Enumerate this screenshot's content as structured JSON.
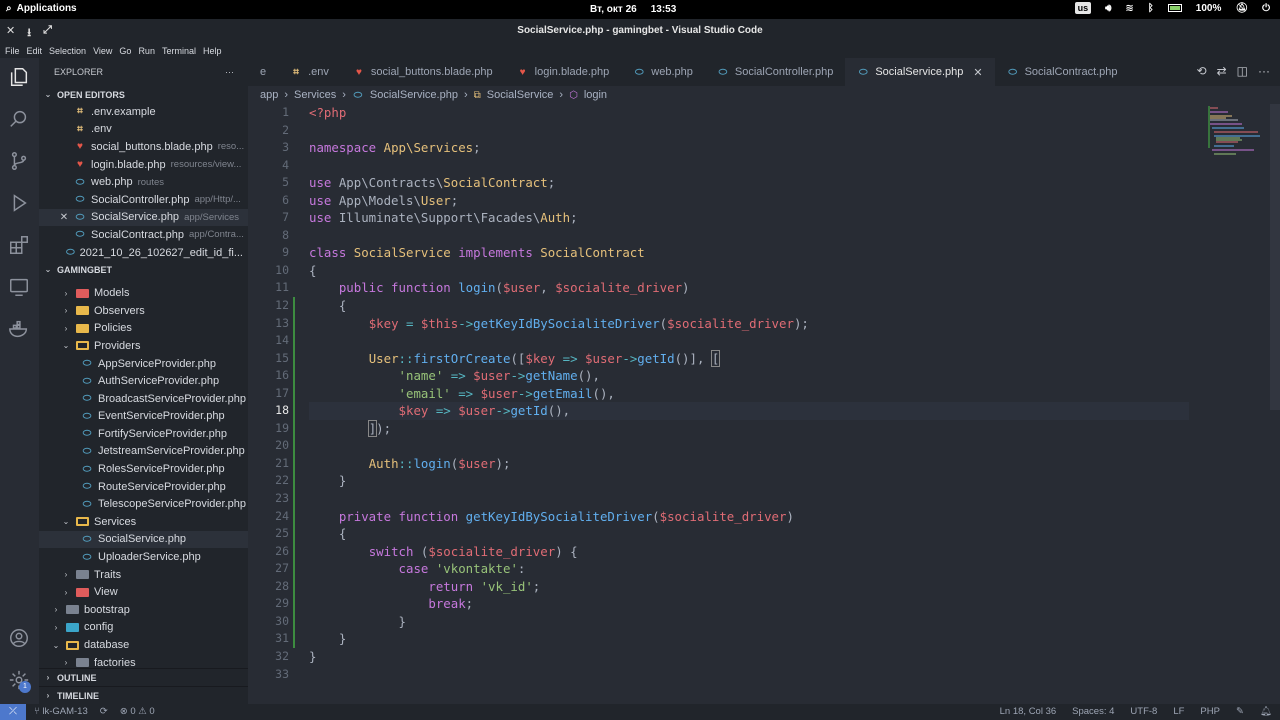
{
  "gnome": {
    "apps_label": "Applications",
    "date": "Вт, окт 26",
    "time": "13:53",
    "lang": "us",
    "battery": "100%"
  },
  "window": {
    "title": "SocialService.php - gamingbet - Visual Studio Code"
  },
  "menu": [
    "File",
    "Edit",
    "Selection",
    "View",
    "Go",
    "Run",
    "Terminal",
    "Help"
  ],
  "sidebar": {
    "title": "EXPLORER",
    "more": "···",
    "open_editors_label": "OPEN EDITORS",
    "open_editors": [
      {
        "icon": "env",
        "glyph": "⌗",
        "name": ".env.example",
        "desc": ""
      },
      {
        "icon": "env",
        "glyph": "⌗",
        "name": ".env",
        "desc": ""
      },
      {
        "icon": "blade",
        "glyph": "♥",
        "name": "social_buttons.blade.php",
        "desc": "reso..."
      },
      {
        "icon": "blade",
        "glyph": "♥",
        "name": "login.blade.php",
        "desc": "resources/view..."
      },
      {
        "icon": "php",
        "glyph": "⬭",
        "name": "web.php",
        "desc": "routes"
      },
      {
        "icon": "php",
        "glyph": "⬭",
        "name": "SocialController.php",
        "desc": "app/Http/..."
      },
      {
        "icon": "php",
        "glyph": "⬭",
        "name": "SocialService.php",
        "desc": "app/Services"
      },
      {
        "icon": "php",
        "glyph": "⬭",
        "name": "SocialContract.php",
        "desc": "app/Contra..."
      },
      {
        "icon": "php",
        "glyph": "⬭",
        "name": "2021_10_26_102627_edit_id_fi...",
        "desc": ""
      }
    ],
    "project_label": "GAMINGBET",
    "tree": [
      {
        "indent": 1,
        "type": "folder",
        "color": "r",
        "name": "Models",
        "chev": "›"
      },
      {
        "indent": 1,
        "type": "folder",
        "color": "y",
        "name": "Observers",
        "chev": "›"
      },
      {
        "indent": 1,
        "type": "folder",
        "color": "y",
        "name": "Policies",
        "chev": "›"
      },
      {
        "indent": 1,
        "type": "folder-open",
        "color": "y",
        "name": "Providers",
        "chev": "⌄"
      },
      {
        "indent": 2,
        "type": "file",
        "name": "AppServiceProvider.php"
      },
      {
        "indent": 2,
        "type": "file",
        "name": "AuthServiceProvider.php"
      },
      {
        "indent": 2,
        "type": "file",
        "name": "BroadcastServiceProvider.php"
      },
      {
        "indent": 2,
        "type": "file",
        "name": "EventServiceProvider.php"
      },
      {
        "indent": 2,
        "type": "file",
        "name": "FortifyServiceProvider.php"
      },
      {
        "indent": 2,
        "type": "file",
        "name": "JetstreamServiceProvider.php"
      },
      {
        "indent": 2,
        "type": "file",
        "name": "RolesServiceProvider.php"
      },
      {
        "indent": 2,
        "type": "file",
        "name": "RouteServiceProvider.php"
      },
      {
        "indent": 2,
        "type": "file",
        "name": "TelescopeServiceProvider.php"
      },
      {
        "indent": 1,
        "type": "folder-open",
        "color": "y",
        "name": "Services",
        "chev": "⌄"
      },
      {
        "indent": 2,
        "type": "file",
        "name": "SocialService.php",
        "selected": true
      },
      {
        "indent": 2,
        "type": "file",
        "name": "UploaderService.php"
      },
      {
        "indent": 1,
        "type": "folder",
        "color": "g",
        "name": "Traits",
        "chev": "›"
      },
      {
        "indent": 1,
        "type": "folder",
        "color": "r",
        "name": "View",
        "chev": "›"
      },
      {
        "indent": 0,
        "type": "folder",
        "color": "g",
        "name": "bootstrap",
        "chev": "›"
      },
      {
        "indent": 0,
        "type": "folder",
        "color": "b",
        "name": "config",
        "chev": "›"
      },
      {
        "indent": 0,
        "type": "folder-open",
        "color": "g",
        "name": "database",
        "chev": "⌄"
      },
      {
        "indent": 1,
        "type": "folder",
        "color": "g",
        "name": "factories",
        "chev": "›"
      }
    ],
    "outline_label": "OUTLINE",
    "timeline_label": "TIMELINE"
  },
  "tabs": [
    {
      "icon": "none",
      "glyph": "",
      "label": "e"
    },
    {
      "icon": "env",
      "glyph": "⌗",
      "label": ".env"
    },
    {
      "icon": "blade",
      "glyph": "♥",
      "label": "social_buttons.blade.php"
    },
    {
      "icon": "blade",
      "glyph": "♥",
      "label": "login.blade.php"
    },
    {
      "icon": "php",
      "glyph": "⬭",
      "label": "web.php"
    },
    {
      "icon": "php",
      "glyph": "⬭",
      "label": "SocialController.php"
    },
    {
      "icon": "php",
      "glyph": "⬭",
      "label": "SocialService.php",
      "active": true
    },
    {
      "icon": "php",
      "glyph": "⬭",
      "label": "SocialContract.php"
    }
  ],
  "breadcrumbs": {
    "p1": "app",
    "p2": "Services",
    "p3": "SocialService.php",
    "p4": "SocialService",
    "p5": "login",
    "sep": "›"
  },
  "editor": {
    "current_line": 18,
    "code_lines": [
      [
        [
          "tag",
          "<?php"
        ]
      ],
      [],
      [
        [
          "kw",
          "namespace "
        ],
        [
          "cls",
          "App\\Services"
        ],
        [
          "",
          "; "
        ]
      ],
      [],
      [
        [
          "kw",
          "use "
        ],
        [
          "",
          "App\\Contracts\\"
        ],
        [
          "cls",
          "SocialContract"
        ],
        [
          "",
          ";"
        ]
      ],
      [
        [
          "kw",
          "use "
        ],
        [
          "",
          "App\\Models\\"
        ],
        [
          "cls",
          "User"
        ],
        [
          "",
          ";"
        ]
      ],
      [
        [
          "kw",
          "use "
        ],
        [
          "",
          "Illuminate\\Support\\Facades\\"
        ],
        [
          "cls",
          "Auth"
        ],
        [
          "",
          ";"
        ]
      ],
      [],
      [
        [
          "kw",
          "class "
        ],
        [
          "cls",
          "SocialService "
        ],
        [
          "kw",
          "implements "
        ],
        [
          "cls",
          "SocialContract"
        ]
      ],
      [
        [
          "",
          "{"
        ]
      ],
      [
        [
          "",
          "    "
        ],
        [
          "kw",
          "public function "
        ],
        [
          "fn",
          "login"
        ],
        [
          "",
          "("
        ],
        [
          "var",
          "$user"
        ],
        [
          "",
          ", "
        ],
        [
          "var",
          "$socialite_driver"
        ],
        [
          "",
          ")"
        ]
      ],
      [
        [
          "",
          "    {"
        ]
      ],
      [
        [
          "",
          "        "
        ],
        [
          "var",
          "$key"
        ],
        [
          "op",
          " = "
        ],
        [
          "var",
          "$this"
        ],
        [
          "op",
          "->"
        ],
        [
          "fn",
          "getKeyIdBySocialiteDriver"
        ],
        [
          "",
          "("
        ],
        [
          "var",
          "$socialite_driver"
        ],
        [
          "",
          ");"
        ]
      ],
      [],
      [
        [
          "",
          "        "
        ],
        [
          "cls",
          "User"
        ],
        [
          "op",
          "::"
        ],
        [
          "fn",
          "firstOrCreate"
        ],
        [
          "",
          "(["
        ],
        [
          "var",
          "$key"
        ],
        [
          "op",
          " => "
        ],
        [
          "var",
          "$user"
        ],
        [
          "op",
          "->"
        ],
        [
          "fn",
          "getId"
        ],
        [
          "",
          "()], "
        ],
        [
          "brk",
          "["
        ]
      ],
      [
        [
          "",
          "            "
        ],
        [
          "str",
          "'name'"
        ],
        [
          "op",
          " => "
        ],
        [
          "var",
          "$user"
        ],
        [
          "op",
          "->"
        ],
        [
          "fn",
          "getName"
        ],
        [
          "",
          "(),"
        ]
      ],
      [
        [
          "",
          "            "
        ],
        [
          "str",
          "'email'"
        ],
        [
          "op",
          " => "
        ],
        [
          "var",
          "$user"
        ],
        [
          "op",
          "->"
        ],
        [
          "fn",
          "getEmail"
        ],
        [
          "",
          "(),"
        ]
      ],
      [
        [
          "",
          "            "
        ],
        [
          "var",
          "$key"
        ],
        [
          "op",
          " => "
        ],
        [
          "var",
          "$user"
        ],
        [
          "op",
          "->"
        ],
        [
          "fn",
          "getId"
        ],
        [
          "",
          "(),"
        ]
      ],
      [
        [
          "",
          "        "
        ],
        [
          "brk",
          "]"
        ],
        [
          "",
          ");"
        ]
      ],
      [],
      [
        [
          "",
          "        "
        ],
        [
          "cls",
          "Auth"
        ],
        [
          "op",
          "::"
        ],
        [
          "fn",
          "login"
        ],
        [
          "",
          "("
        ],
        [
          "var",
          "$user"
        ],
        [
          "",
          ");"
        ]
      ],
      [
        [
          "",
          "    }"
        ]
      ],
      [],
      [
        [
          "",
          "    "
        ],
        [
          "kw",
          "private function "
        ],
        [
          "fn",
          "getKeyIdBySocialiteDriver"
        ],
        [
          "",
          "("
        ],
        [
          "var",
          "$socialite_driver"
        ],
        [
          "",
          ")"
        ]
      ],
      [
        [
          "",
          "    {"
        ]
      ],
      [
        [
          "",
          "        "
        ],
        [
          "kw",
          "switch "
        ],
        [
          "",
          "("
        ],
        [
          "var",
          "$socialite_driver"
        ],
        [
          "",
          ") {"
        ]
      ],
      [
        [
          "",
          "            "
        ],
        [
          "kw",
          "case "
        ],
        [
          "str",
          "'vkontakte'"
        ],
        [
          "",
          ":"
        ]
      ],
      [
        [
          "",
          "                "
        ],
        [
          "kw",
          "return "
        ],
        [
          "str",
          "'vk_id'"
        ],
        [
          "",
          ";"
        ]
      ],
      [
        [
          "",
          "                "
        ],
        [
          "kw",
          "break"
        ],
        [
          "",
          ";"
        ]
      ],
      [
        [
          "",
          "            }"
        ]
      ],
      [
        [
          "",
          "    }"
        ]
      ],
      [
        [
          "",
          "}"
        ]
      ],
      []
    ]
  },
  "status": {
    "branch": "lk-GAM-13",
    "problems": "⊗ 0 ⚠ 0",
    "position": "Ln 18, Col 36",
    "spaces": "Spaces: 4",
    "encoding": "UTF-8",
    "eol": "LF",
    "language": "PHP"
  },
  "colors": {
    "keyword": "#c678dd",
    "class": "#e5c07b",
    "variable": "#e06c75",
    "function": "#61afef",
    "string": "#98c379",
    "operator": "#56b6c2"
  }
}
